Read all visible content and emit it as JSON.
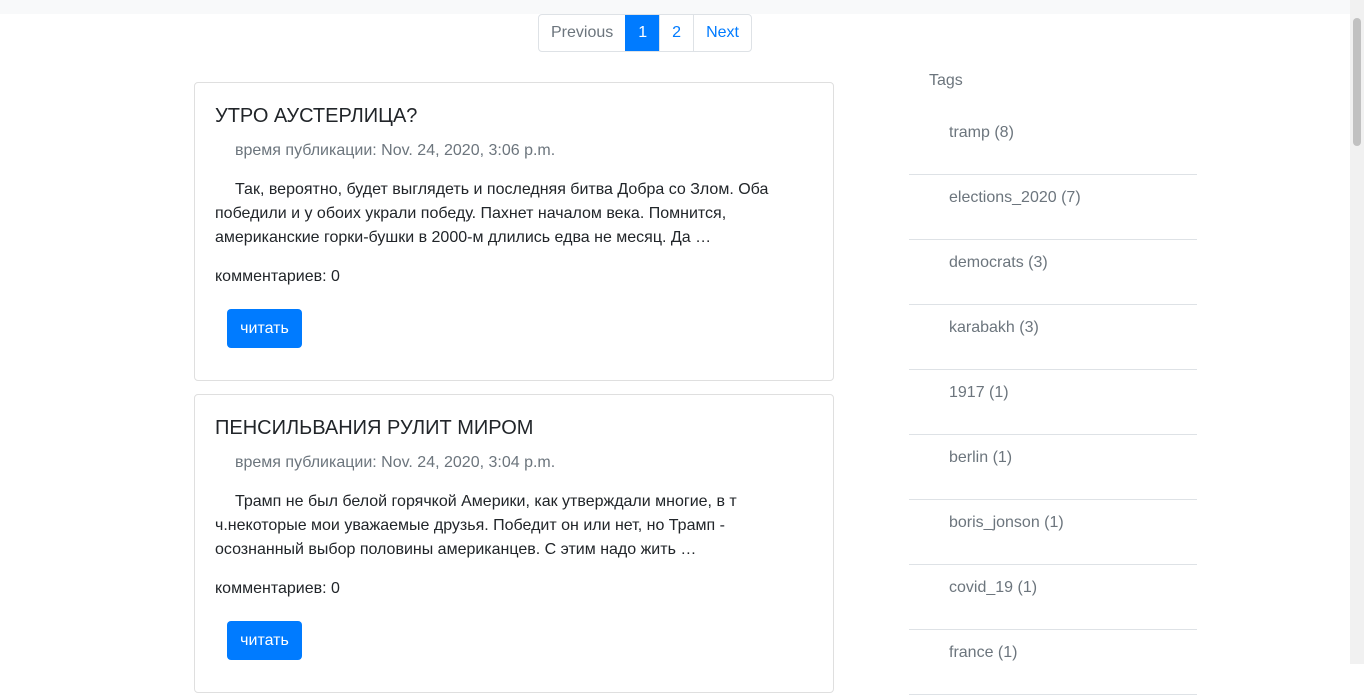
{
  "pagination": {
    "previous": "Previous",
    "page1": "1",
    "page2": "2",
    "next": "Next"
  },
  "posts": [
    {
      "title": "УТРО АУСТЕРЛИЦА?",
      "meta": "время публикации: Nov. 24, 2020, 3:06 p.m.",
      "excerpt": "Так, вероятно, будет выглядеть и последняя битва Добра со Злом. Оба победили и у обоих украли победу. Пахнет началом века. Помнится, американские горки-бушки в 2000-м длились едва не месяц. Да …",
      "comments": "комментариев: 0",
      "read_label": "читать"
    },
    {
      "title": "ПЕНСИЛЬВАНИЯ РУЛИТ МИРОМ",
      "meta": "время публикации: Nov. 24, 2020, 3:04 p.m.",
      "excerpt": "Трамп не был белой горячкой Америки, как утверждали многие, в т ч.некоторые мои уважаемые друзья. Победит он или нет, но Трамп - осознанный выбор половины американцев. С этим надо жить …",
      "comments": "комментариев: 0",
      "read_label": "читать"
    }
  ],
  "sidebar": {
    "heading": "Tags",
    "tags": [
      "tramp (8)",
      "elections_2020 (7)",
      "democrats (3)",
      "karabakh (3)",
      "1917 (1)",
      "berlin (1)",
      "boris_jonson (1)",
      "covid_19 (1)",
      "france (1)"
    ]
  },
  "colors": {
    "primary": "#007bff",
    "muted": "#6c757d",
    "border": "#dee2e6"
  }
}
